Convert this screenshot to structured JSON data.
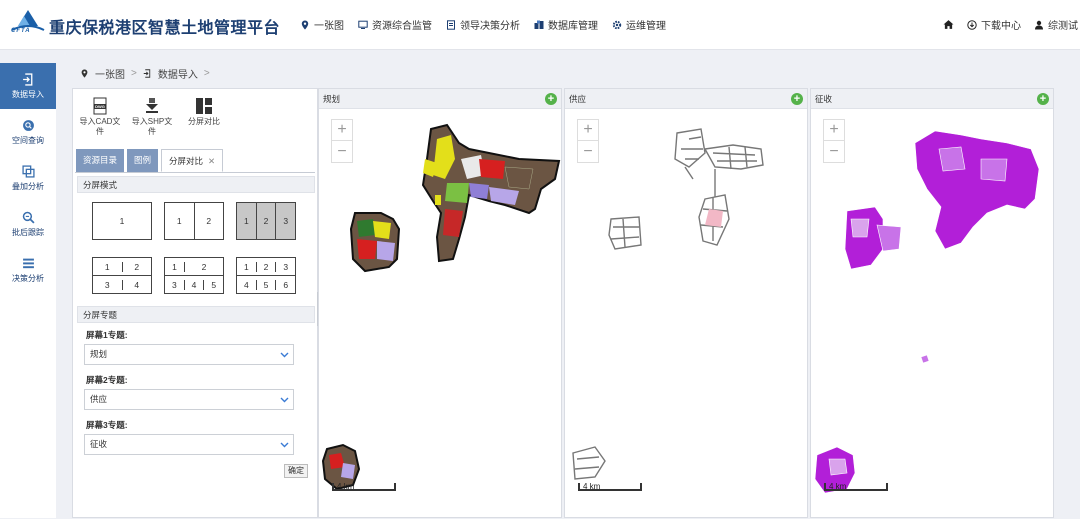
{
  "app": {
    "title": "重庆保税港区智慧土地管理平台",
    "logo_text": "CFTA"
  },
  "nav": {
    "items": [
      {
        "label": "一张图",
        "icon": "location-pin-icon"
      },
      {
        "label": "资源综合监管",
        "icon": "monitor-icon"
      },
      {
        "label": "领导决策分析",
        "icon": "document-icon"
      },
      {
        "label": "数据库管理",
        "icon": "database-icon"
      },
      {
        "label": "运维管理",
        "icon": "gear-icon"
      }
    ]
  },
  "topright": {
    "download": "下载中心",
    "user": "综测试"
  },
  "sidebar": {
    "items": [
      {
        "label": "数据导入",
        "icon": "import-icon",
        "active": true
      },
      {
        "label": "空间查询",
        "icon": "search-circle-icon",
        "active": false
      },
      {
        "label": "叠加分析",
        "icon": "overlay-icon",
        "active": false
      },
      {
        "label": "批后跟踪",
        "icon": "magnifier-icon",
        "active": false
      },
      {
        "label": "决策分析",
        "icon": "list-icon",
        "active": false
      }
    ]
  },
  "breadcrumb": {
    "home": "一张图",
    "current": "数据导入",
    "sep": ">"
  },
  "tools": [
    {
      "label": "导入CAD文件",
      "icon": "cad-file-icon"
    },
    {
      "label": "导入SHP文件",
      "icon": "shp-download-icon"
    },
    {
      "label": "分屏对比",
      "icon": "split-screen-icon"
    }
  ],
  "tabs": [
    {
      "label": "资源目录",
      "active": false
    },
    {
      "label": "图例",
      "active": false
    },
    {
      "label": "分屏对比",
      "active": true,
      "closable": true
    }
  ],
  "split": {
    "mode_title": "分屏模式",
    "layouts_row1": [
      [
        "1"
      ],
      [
        "1",
        "2"
      ],
      [
        "1",
        "2",
        "3"
      ]
    ],
    "layouts_row2": [
      {
        "top": [
          "1",
          "2"
        ],
        "bottom": [
          "3",
          "4"
        ]
      },
      {
        "top": [
          "1",
          "2"
        ],
        "bottom": [
          "3",
          "4",
          "5"
        ]
      },
      {
        "top": [
          "1",
          "2",
          "3"
        ],
        "bottom": [
          "4",
          "5",
          "6"
        ]
      }
    ],
    "selected_layout": "1-2-3",
    "topic_title": "分屏专题",
    "screens": [
      {
        "label": "屏幕1专题:",
        "value": "规划"
      },
      {
        "label": "屏幕2专题:",
        "value": "供应"
      },
      {
        "label": "屏幕3专题:",
        "value": "征收"
      }
    ],
    "confirm": "确定"
  },
  "maps": [
    {
      "title": "规划",
      "scale": "4 km"
    },
    {
      "title": "供应",
      "scale": "4 km"
    },
    {
      "title": "征收",
      "scale": "4 km"
    }
  ],
  "colors": {
    "accent": "#3a6fae",
    "tab": "#7f98bd",
    "add": "#55b24a",
    "purple": "#b21fd8",
    "brown": "#6b5543",
    "red": "#d62020",
    "yellow": "#e3df1a"
  }
}
